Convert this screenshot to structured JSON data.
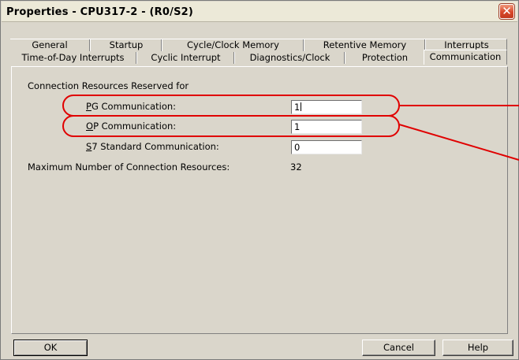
{
  "window": {
    "title": "Properties - CPU317-2 - (R0/S2)",
    "close_glyph": "✕"
  },
  "tabs_row1": [
    "General",
    "Startup",
    "Cycle/Clock Memory",
    "Retentive Memory",
    "Interrupts"
  ],
  "tabs_row2": [
    "Time-of-Day Interrupts",
    "Cyclic Interrupt",
    "Diagnostics/Clock",
    "Protection",
    "Communication"
  ],
  "active_tab": "Communication",
  "panel": {
    "section_heading": "Connection Resources Reserved for",
    "pg": {
      "label_mnemonic": "P",
      "label_rest": "G Communication:",
      "value": "1"
    },
    "op": {
      "label_mnemonic": "O",
      "label_rest": "P Communication:",
      "value": "1"
    },
    "s7": {
      "label_mnemonic": "S",
      "label_rest": "7 Standard Communication:",
      "value": "0"
    },
    "max_label": "Maximum Number of Connection Resources:",
    "max_value": "32"
  },
  "buttons": {
    "ok": "OK",
    "cancel": "Cancel",
    "help": "Help"
  },
  "annotation": {
    "color": "#e00000"
  },
  "icons": {
    "close": "close-icon"
  }
}
